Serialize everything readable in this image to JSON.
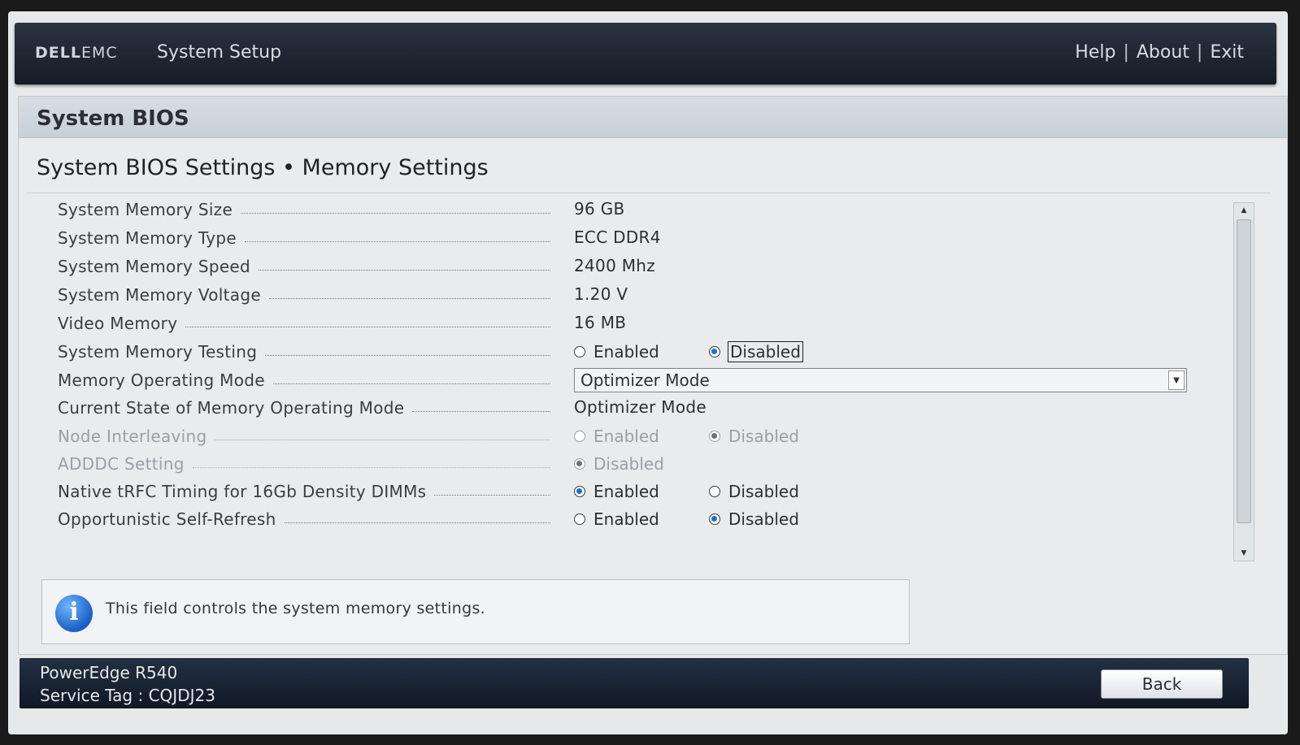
{
  "header": {
    "logo_dell": "DELL",
    "logo_emc": "EMC",
    "app_title": "System Setup",
    "links": [
      "Help",
      "About",
      "Exit"
    ],
    "sep": "|"
  },
  "panel": {
    "title": "System BIOS",
    "subtitle": "System BIOS Settings • Memory Settings"
  },
  "settings": [
    {
      "label": "System Memory Size",
      "value": "96 GB"
    },
    {
      "label": "System Memory Type",
      "value": "ECC DDR4"
    },
    {
      "label": "System Memory Speed",
      "value": "2400 Mhz"
    },
    {
      "label": "System Memory Voltage",
      "value": "1.20 V"
    },
    {
      "label": "Video Memory",
      "value": "16 MB"
    },
    {
      "label": "System Memory Testing",
      "options": [
        "Enabled",
        "Disabled"
      ],
      "selected": "Disabled"
    },
    {
      "label": "Memory Operating Mode",
      "value": "Optimizer Mode"
    },
    {
      "label": "Current State of Memory Operating Mode",
      "value": "Optimizer Mode"
    },
    {
      "label": "Node Interleaving",
      "options": [
        "Enabled",
        "Disabled"
      ],
      "selected": "Disabled",
      "disabled": true
    },
    {
      "label": "ADDDC Setting",
      "options": [
        "Disabled"
      ],
      "selected": "Disabled",
      "disabled": true
    },
    {
      "label": "Native tRFC Timing for 16Gb Density DIMMs",
      "options": [
        "Enabled",
        "Disabled"
      ],
      "selected": "Enabled"
    },
    {
      "label": "Opportunistic Self-Refresh",
      "options": [
        "Enabled",
        "Disabled"
      ],
      "selected": "Disabled"
    }
  ],
  "help": {
    "icon": "info-icon",
    "icon_glyph": "i",
    "text": "This field controls the system memory settings."
  },
  "footer": {
    "model": "PowerEdge R540",
    "service_tag": "Service Tag : CQJDJ23",
    "back_label": "Back"
  },
  "colors": {
    "accent": "#1f6fd1",
    "topbar": "#1d2531"
  }
}
